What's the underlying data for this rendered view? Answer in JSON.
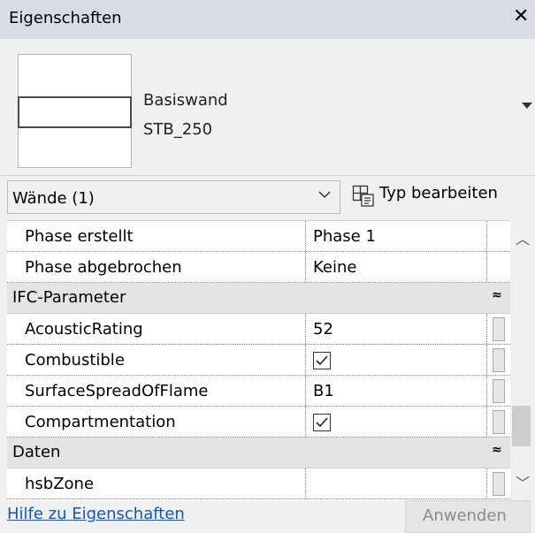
{
  "panel": {
    "title": "Eigenschaften"
  },
  "type_selector": {
    "family": "Basiswand",
    "type": "STB_250"
  },
  "filter": {
    "selected": "Wände (1)",
    "edit_type_label": "Typ bearbeiten"
  },
  "grid": {
    "rows": [
      {
        "kind": "param",
        "name": "Phase erstellt",
        "value": "Phase 1"
      },
      {
        "kind": "param",
        "name": "Phase abgebrochen",
        "value": "Keine"
      },
      {
        "kind": "group",
        "name": "IFC-Parameter",
        "toggle": "≈"
      },
      {
        "kind": "param",
        "name": "AcousticRating",
        "value": "52"
      },
      {
        "kind": "param",
        "name": "Combustible",
        "checked": true
      },
      {
        "kind": "param",
        "name": "SurfaceSpreadOfFlame",
        "value": "B1"
      },
      {
        "kind": "param",
        "name": "Compartmentation",
        "checked": true
      },
      {
        "kind": "group",
        "name": "Daten",
        "toggle": "≈"
      },
      {
        "kind": "param",
        "name": "hsbZone",
        "value": ""
      }
    ]
  },
  "footer": {
    "help_link": "Hilfe zu Eigenschaften",
    "apply_button": "Anwenden",
    "apply_enabled": false
  },
  "colors": {
    "title_bar": "#d8dde5",
    "group_header": "#e4e4e4",
    "link": "#0b57c8"
  },
  "icons": [
    "close-icon",
    "dropdown-arrow-icon",
    "chevron-down-icon",
    "edit-type-icon",
    "checkbox-checked-icon",
    "collapse-icon",
    "scroll-up-icon",
    "scroll-down-icon"
  ]
}
